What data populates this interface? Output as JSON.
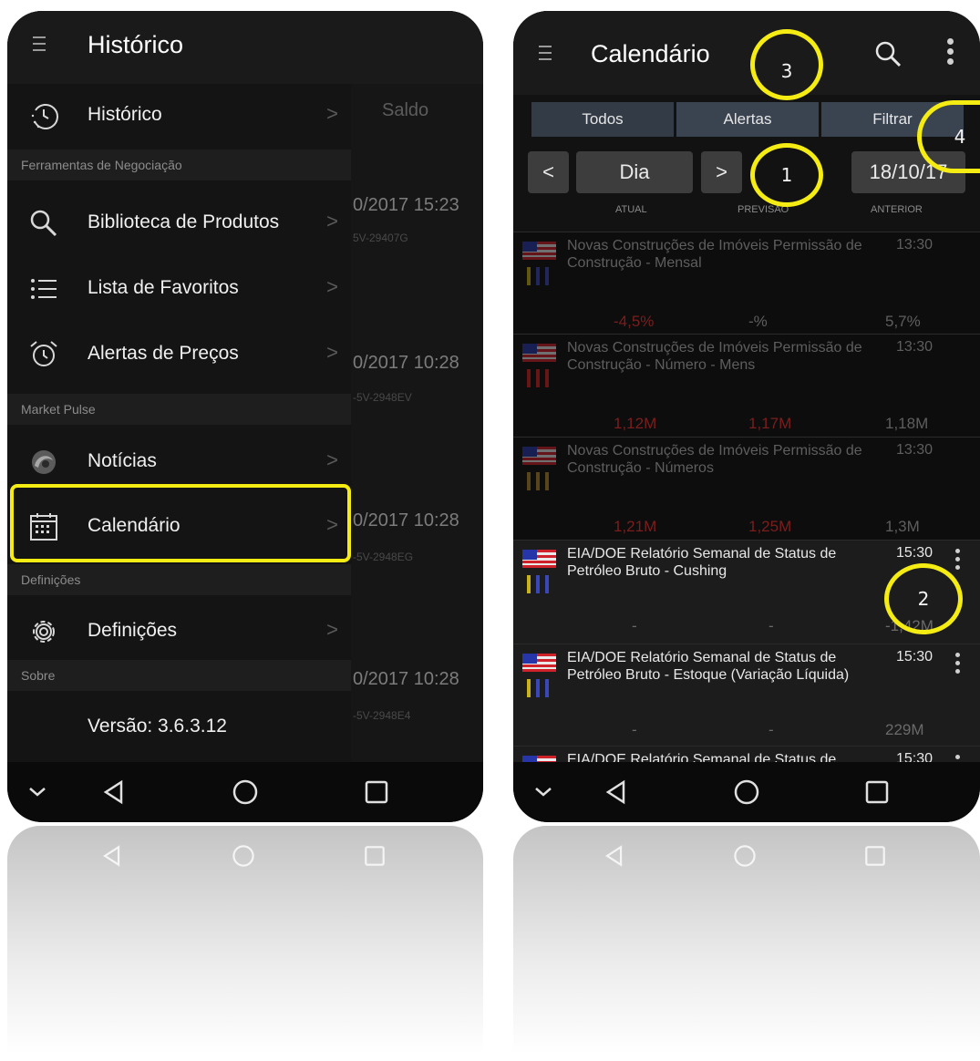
{
  "left_screen": {
    "title": "Histórico",
    "menu": [
      {
        "label": "Histórico",
        "icon": "history-icon"
      },
      {
        "label": "Biblioteca de Produtos",
        "icon": "search-icon"
      },
      {
        "label": "Lista de Favoritos",
        "icon": "list-icon"
      },
      {
        "label": "Alertas de Preços",
        "icon": "alarm-clock-icon"
      },
      {
        "label": "Notícias",
        "icon": "news-icon"
      },
      {
        "label": "Calendário",
        "icon": "calendar-icon"
      },
      {
        "label": "Definições",
        "icon": "gear-icon"
      }
    ],
    "sections": [
      "Ferramentas de Negociação",
      "Market Pulse",
      "Definições",
      "Sobre"
    ],
    "version": "Versão: 3.6.3.12",
    "background": {
      "header": "Saldo",
      "rows": [
        {
          "datetime": "0/2017 15:23",
          "id": "5V-29407G"
        },
        {
          "datetime": "0/2017 10:28",
          "id": "-5V-2948EV"
        },
        {
          "datetime": "0/2017 10:28",
          "id": "-5V-2948EG"
        },
        {
          "datetime": "0/2017 10:28",
          "id": "-5V-2948E4"
        }
      ]
    }
  },
  "right_screen": {
    "title": "Calendário",
    "tabs": [
      "Todos",
      "Alertas",
      "Filtrar"
    ],
    "period": "Dia",
    "date": "18/10/17",
    "columns": [
      "ATUAL",
      "PREVISÃO",
      "ANTERIOR"
    ],
    "events": [
      {
        "name": "Novas Construções de Imóveis Permissão de Construção - Mensal",
        "time": "13:30",
        "actual": "-4,5%",
        "forecast": "-%",
        "previous": "5,7%",
        "importance": "low",
        "dimmed": true
      },
      {
        "name": "Novas Construções de Imóveis Permissão de Construção - Número - Mens",
        "time": "13:30",
        "actual": "1,12M",
        "forecast": "1,17M",
        "previous": "1,18M",
        "importance": "high",
        "dimmed": true
      },
      {
        "name": "Novas Construções de Imóveis Permissão de Construção - Números",
        "time": "13:30",
        "actual": "1,21M",
        "forecast": "1,25M",
        "previous": "1,3M",
        "importance": "medium",
        "dimmed": true
      },
      {
        "name": "EIA/DOE Relatório Semanal de Status de Petróleo Bruto - Cushing",
        "time": "15:30",
        "actual": "-",
        "forecast": "-",
        "previous": "-1,42M",
        "importance": "low",
        "dimmed": false
      },
      {
        "name": "EIA/DOE Relatório Semanal de Status de Petróleo Bruto - Estoque (Variação Líquida)",
        "time": "15:30",
        "actual": "-",
        "forecast": "-",
        "previous": "229M",
        "importance": "low",
        "dimmed": false
      },
      {
        "name": "EIA/DOE Relatório Semanal de Status de",
        "time": "15:30",
        "actual": "",
        "forecast": "",
        "previous": "",
        "importance": "low",
        "dimmed": false
      }
    ]
  },
  "annotations": [
    "1",
    "2",
    "3",
    "4"
  ],
  "colors": {
    "highlight": "#f5ec13",
    "tab_bg": "#3a4350",
    "negative": "#e02a2a",
    "importance_low": "#c9b21a",
    "importance_high": "#d62020"
  }
}
